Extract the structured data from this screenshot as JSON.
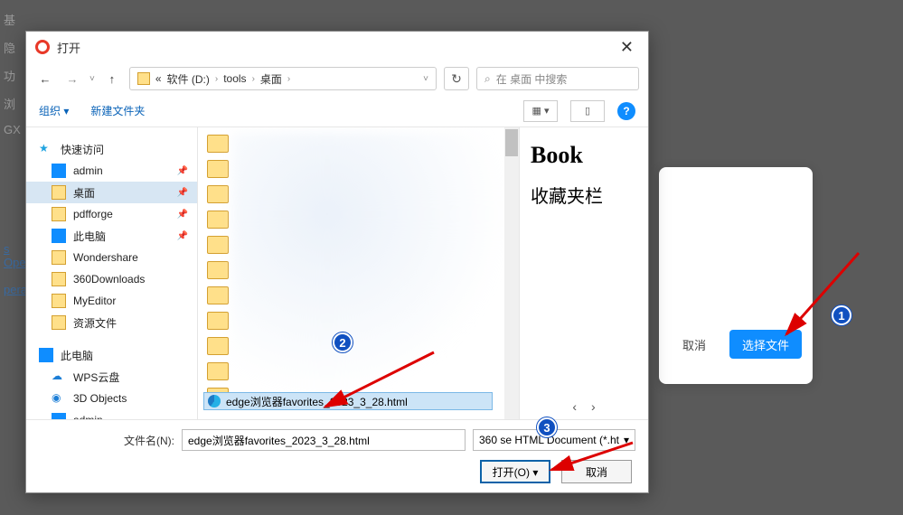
{
  "bg": {
    "left_items": [
      "基",
      "隐",
      "功",
      "浏",
      "GX"
    ],
    "left_bottom": [
      "s Ope",
      "pera"
    ],
    "card": {
      "cancel": "取消",
      "select": "选择文件"
    }
  },
  "dialog": {
    "title": "打开",
    "breadcrumb": {
      "prefix": "«",
      "parts": [
        "软件 (D:)",
        "tools",
        "桌面"
      ]
    },
    "search_placeholder": "在 桌面 中搜索",
    "toolbar": {
      "organize": "组织",
      "new_folder": "新建文件夹"
    },
    "sidebar": {
      "quick_access": "快速访问",
      "items": [
        {
          "label": "admin",
          "icon": "monitor"
        },
        {
          "label": "桌面",
          "icon": "folder",
          "selected": true
        },
        {
          "label": "pdfforge",
          "icon": "folder"
        },
        {
          "label": "此电脑",
          "icon": "pc"
        },
        {
          "label": "Wondershare",
          "icon": "folder"
        },
        {
          "label": "360Downloads",
          "icon": "folder"
        },
        {
          "label": "MyEditor",
          "icon": "folder"
        },
        {
          "label": "资源文件",
          "icon": "folder"
        }
      ],
      "this_pc": "此电脑",
      "pc_items": [
        {
          "label": "WPS云盘",
          "icon": "cloud"
        },
        {
          "label": "3D Objects",
          "icon": "3d"
        },
        {
          "label": "admin",
          "icon": "monitor"
        }
      ]
    },
    "selected_file": "edge浏览器favorites_2023_3_28.html",
    "preview": {
      "heading": "Book",
      "sub": "收藏夹栏"
    },
    "footer": {
      "filename_label": "文件名(N):",
      "filename_value": "edge浏览器favorites_2023_3_28.html",
      "filter": "360 se HTML Document (*.ht",
      "open": "打开(O)",
      "cancel": "取消"
    }
  },
  "annotations": {
    "b1": "1",
    "b2": "2",
    "b3": "3"
  }
}
